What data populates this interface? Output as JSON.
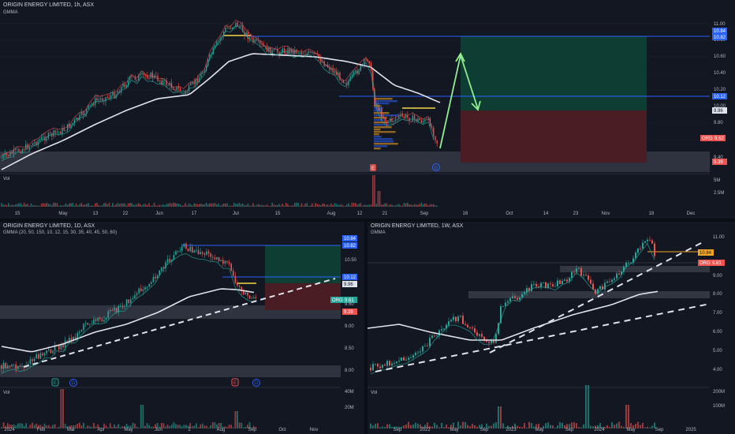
{
  "colors": {
    "background": "#131722",
    "up": "#26a69a",
    "down": "#ef5350",
    "grid": "#1e222d",
    "zone": "#3a3e4a",
    "blue_line": "#2962ff",
    "target_green": "#0e3d33",
    "stop_red": "#4a1c24",
    "gmma_long": "#e0e3eb",
    "arrow": "#90ee90",
    "yellow": "#f5d547",
    "text": "#d1d4dc"
  },
  "panes": {
    "top": {
      "title": "ORIGIN ENERGY LIMITED, 1h, ASX",
      "indicator": "GMMA",
      "vol_label": "Vol",
      "price_labels": [
        "11.00",
        "10.80",
        "10.60",
        "10.40",
        "10.20",
        "10.00",
        "9.80",
        "9.60",
        "9.40"
      ],
      "badges": {
        "a": "10.84",
        "b": "10.82",
        "c": "10.12",
        "d": "9.96",
        "orig": "ORG",
        "orig_val": "9.62",
        "e": "9.39"
      },
      "vol_scale": [
        "5M",
        "2.5M"
      ],
      "x_labels": [
        "15",
        "May",
        "13",
        "22",
        "Jun",
        "17",
        "Jul",
        "15",
        "Aug",
        "12",
        "21",
        "Sep",
        "16",
        "Oct",
        "14",
        "23",
        "Nov",
        "18",
        "Dec"
      ],
      "markers": [
        "E",
        "D"
      ]
    },
    "bottom_left": {
      "title": "ORIGIN ENERGY LIMITED, 1D, ASX",
      "indicator": "GMMA (20, 50, 150, 10, 12, 15, 30, 35, 40, 45, 50, 60)",
      "vol_label": "Vol",
      "price_labels": [
        "10.50",
        "9.50",
        "9.00",
        "8.50",
        "8.00"
      ],
      "badges": {
        "a": "10.84",
        "b": "10.82",
        "c": "10.12",
        "d": "9.96",
        "orig": "ORG",
        "orig_val": "9.61",
        "e": "9.39"
      },
      "vol_scale": [
        "40M",
        "20M"
      ],
      "x_labels": [
        "2024",
        "Feb",
        "Mar",
        "Apr",
        "May",
        "Jun",
        "2",
        "Aug",
        "Sep",
        "Oct",
        "Nov"
      ],
      "markers": [
        "E",
        "D",
        "E",
        "D"
      ]
    },
    "bottom_right": {
      "title": "ORIGIN ENERGY LIMITED, 1W, ASX",
      "indicator": "GMMA",
      "vol_label": "Vol",
      "price_labels": [
        "11.00",
        "9.00",
        "8.00",
        "7.00",
        "6.00",
        "5.00",
        "4.00"
      ],
      "badges": {
        "a": "10.84",
        "orig": "ORG",
        "orig_val": "9.61"
      },
      "vol_scale": [
        "200M",
        "100M"
      ],
      "x_labels": [
        "Sep",
        "2022",
        "May",
        "Sep",
        "2023",
        "May",
        "Sep",
        "2024",
        "May",
        "Sep",
        "2025"
      ]
    }
  }
}
